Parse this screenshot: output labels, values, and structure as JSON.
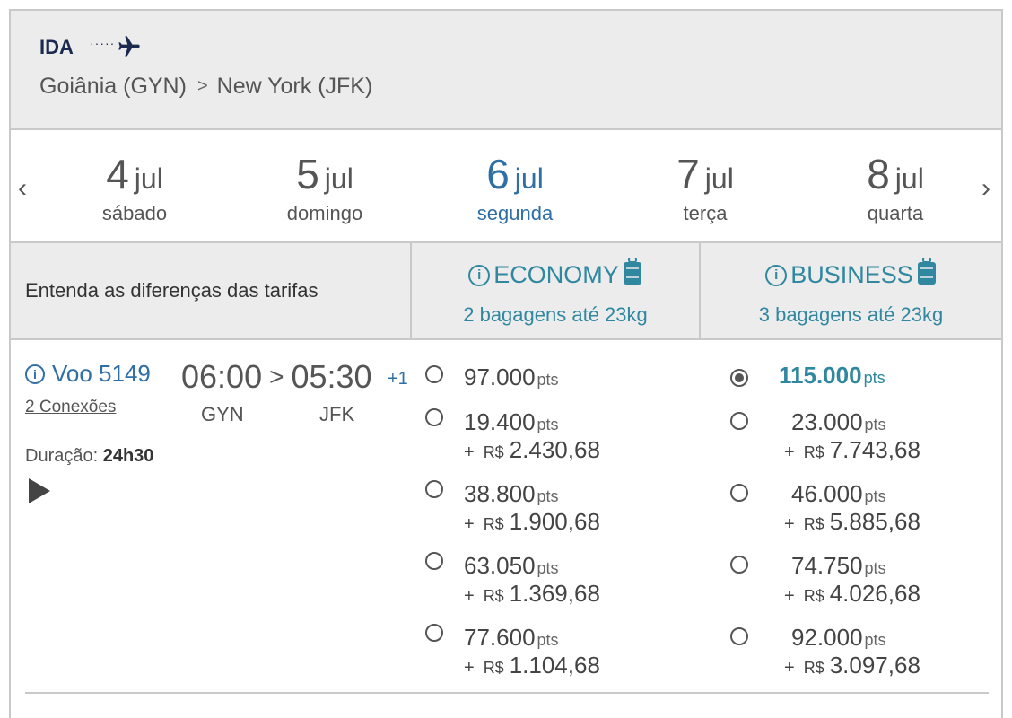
{
  "header": {
    "direction": "IDA",
    "dots": "·····",
    "origin": "Goiânia (GYN)",
    "separator": ">",
    "destination": "New York (JFK)"
  },
  "dates": {
    "prev": "‹",
    "next": "›",
    "items": [
      {
        "day": "4",
        "month": "jul",
        "weekday": "sábado"
      },
      {
        "day": "5",
        "month": "jul",
        "weekday": "domingo"
      },
      {
        "day": "6",
        "month": "jul",
        "weekday": "segunda"
      },
      {
        "day": "7",
        "month": "jul",
        "weekday": "terça"
      },
      {
        "day": "8",
        "month": "jul",
        "weekday": "quarta"
      }
    ]
  },
  "fares": {
    "compare_label": "Entenda as diferenças das tarifas",
    "economy": {
      "name": "ECONOMY",
      "bags": "2 bagagens até 23kg"
    },
    "business": {
      "name": "BUSINESS",
      "bags": "3 bagagens até 23kg"
    }
  },
  "flight": {
    "number": "Voo 5149",
    "connections": "2 Conexões",
    "depart": "06:00",
    "arrow": ">",
    "arrive": "05:30",
    "plus_day": "+1",
    "from": "GYN",
    "to": "JFK",
    "duration_label": "Duração:",
    "duration": "24h30"
  },
  "options": {
    "pts_unit": "pts",
    "plus": "+",
    "currency": "R$",
    "economy": [
      {
        "points": "97.000",
        "money": ""
      },
      {
        "points": "19.400",
        "money": "2.430,68"
      },
      {
        "points": "38.800",
        "money": "1.900,68"
      },
      {
        "points": "63.050",
        "money": "1.369,68"
      },
      {
        "points": "77.600",
        "money": "1.104,68"
      }
    ],
    "business": [
      {
        "points": "115.000",
        "money": ""
      },
      {
        "points": "23.000",
        "money": "7.743,68"
      },
      {
        "points": "46.000",
        "money": "5.885,68"
      },
      {
        "points": "74.750",
        "money": "4.026,68"
      },
      {
        "points": "92.000",
        "money": "3.097,68"
      }
    ]
  },
  "colors": {
    "accent": "#2f87a0",
    "link": "#2f6fa6",
    "panel": "#ececec"
  }
}
